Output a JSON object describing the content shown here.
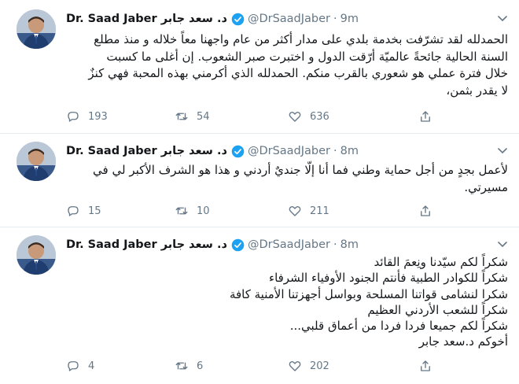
{
  "tweets": [
    {
      "name": "Dr. Saad Jaber د. سعد جابر",
      "handle": "@DrSaadJaber",
      "separator": "·",
      "time": "9m",
      "text": "الحمدلله لقد تشرّفت بخدمة بلدي على مدار أكثر من عام واجهنا معاً خلاله و منذ مطلع\nالسنة الحالية جائحةً عالميّة أرّقت الدول و اختبرت صبر الشعوب. إن أغلى ما كسبت\nخلال فترة عملي هو شعوري بالقرب منكم. الحمدلله الذي أكرمني بهذه المحبة فهي كنزٌ\nلا يقدر بثمن،",
      "replies": "193",
      "retweets": "54",
      "likes": "636"
    },
    {
      "name": "Dr. Saad Jaber د. سعد جابر",
      "handle": "@DrSaadJaber",
      "separator": "·",
      "time": "8m",
      "text": "لأعمل بجدٍ من أجل حماية وطني فما أنا إلّا جنديٌ أردني و هذا هو الشرف الأكبر لي في\nمسيرتي.",
      "replies": "15",
      "retweets": "10",
      "likes": "211"
    },
    {
      "name": "Dr. Saad Jaber د. سعد جابر",
      "handle": "@DrSaadJaber",
      "separator": "·",
      "time": "8m",
      "text": "شكراً لكم سيّدنا ونِعمَ القائد\nشكراً للكوادر الطبية فأنتم الجنود الأوفياء الشرفاء\nشكرا لنشامى قواتنا المسلحة  وبواسل أجهزتنا الأمنية كافة\nشكراً للشعب الأردني العظيم\nشكراً لكم جميعا فردا فردا من أعماق قلبي...\nأخوكم د.سعد جابر",
      "replies": "4",
      "retweets": "6",
      "likes": "202"
    }
  ],
  "icons": {
    "reply": "reply-icon",
    "retweet": "retweet-icon",
    "like": "like-icon",
    "share": "share-icon",
    "verified": "verified-badge-icon",
    "caret": "chevron-down-icon"
  },
  "colors": {
    "accent": "#1da1f2",
    "secondary_text": "#657786",
    "divider": "#e6ecf0"
  }
}
